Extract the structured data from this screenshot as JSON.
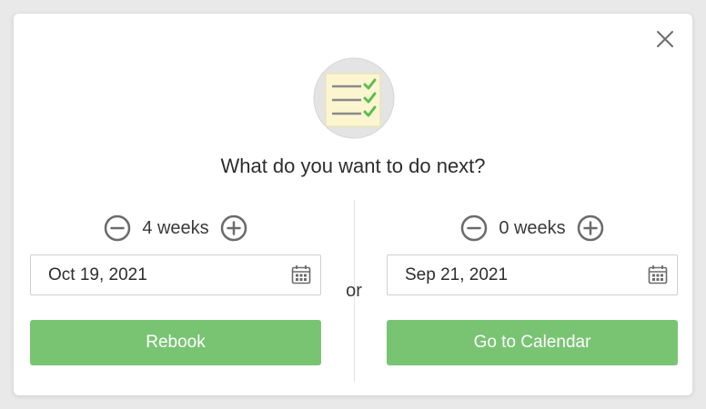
{
  "dialog": {
    "title": "What do you want to do next?",
    "separator": "or"
  },
  "left": {
    "weeks_label": "4 weeks",
    "date_value": "Oct 19, 2021",
    "button_label": "Rebook"
  },
  "right": {
    "weeks_label": "0 weeks",
    "date_value": "Sep 21, 2021",
    "button_label": "Go to Calendar"
  },
  "icons": {
    "close": "close-icon",
    "minus": "minus-circle-icon",
    "plus": "plus-circle-icon",
    "calendar": "calendar-icon",
    "hero": "checklist-icon"
  },
  "colors": {
    "primary_button": "#79c473",
    "check": "#5cbd55",
    "hero_circle": "#e4e4e4",
    "note_paper": "#fbf5d0"
  }
}
